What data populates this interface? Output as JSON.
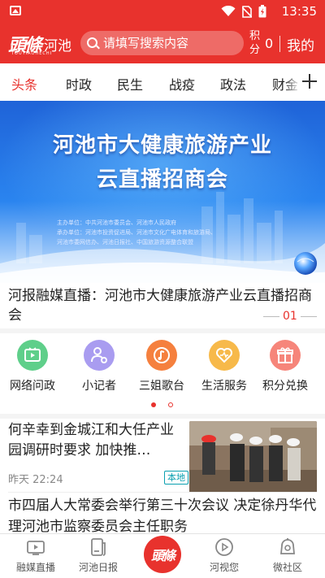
{
  "status_bar": {
    "time": "13:35"
  },
  "header": {
    "logo_main": "頭條",
    "logo_city": "河池",
    "logo_pinyin": "TOUTIAOHECHI",
    "search_placeholder": "请填写搜索内容",
    "points_label": "积分",
    "points_value": "0",
    "mine_label": "我的"
  },
  "tabs": [
    {
      "label": "头条",
      "active": true
    },
    {
      "label": "时政",
      "active": false
    },
    {
      "label": "民生",
      "active": false
    },
    {
      "label": "战疫",
      "active": false
    },
    {
      "label": "政法",
      "active": false
    },
    {
      "label": "财金",
      "active": false
    }
  ],
  "banner": {
    "title_line1": "河池市大健康旅游产业",
    "title_line2": "云直播招商会",
    "organizer": "主办单位：中共河池市委员会、河池市人民政府",
    "co_organizer": "承办单位：河池市投资促进局、河池市文化广电体育和旅游局、",
    "co_organizer_2": "河池市委网信办、河池日报社、中国旅游资源整合联盟",
    "caption": "河报融媒直播：河池市大健康旅游产业云直播招商会",
    "page_indicator": "01"
  },
  "quick_entries": [
    {
      "label": "网络问政",
      "icon": "tv-icon",
      "color": "#5fcf8a"
    },
    {
      "label": "小记者",
      "icon": "reporter-icon",
      "color": "#a99cf0"
    },
    {
      "label": "三姐歌台",
      "icon": "music-icon",
      "color": "#f5803e"
    },
    {
      "label": "生活服务",
      "icon": "heart-icon",
      "color": "#f7b94a"
    },
    {
      "label": "积分兑换",
      "icon": "gift-icon",
      "color": "#f6857a"
    }
  ],
  "news": [
    {
      "title": "何辛幸到金城江和大任产业园调研时要求 加快推…",
      "time": "昨天 22:24",
      "badge": "本地"
    },
    {
      "title": "市四届人大常委会举行第三十次会议 决定徐丹华代理河池市监察委员会主任职务"
    }
  ],
  "bottom_nav": [
    {
      "label": "融媒直播",
      "icon": "tv-icon"
    },
    {
      "label": "河池日报",
      "icon": "newspaper-icon"
    },
    {
      "label": "頭條",
      "icon": "home-logo-icon"
    },
    {
      "label": "河视您",
      "icon": "play-icon"
    },
    {
      "label": "微社区",
      "icon": "community-icon"
    }
  ],
  "colors": {
    "brand_red": "#e8322d",
    "badge_teal": "#0aa0b0"
  }
}
